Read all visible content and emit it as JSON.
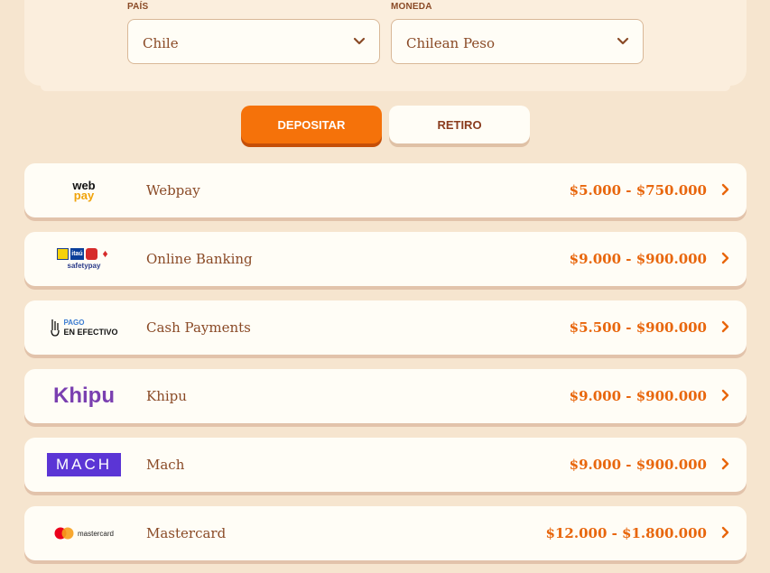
{
  "filters": {
    "country": {
      "label": "PAÍS",
      "value": "Chile"
    },
    "currency": {
      "label": "MONEDA",
      "value": "Chilean Peso"
    }
  },
  "tabs": [
    {
      "label": "DEPOSITAR",
      "active": true
    },
    {
      "label": "RETIRO",
      "active": false
    }
  ],
  "methods": [
    {
      "name": "Webpay",
      "range": "$5.000 - $750.000",
      "logo_text_1": "web",
      "logo_text_2": "pay"
    },
    {
      "name": "Online Banking",
      "range": "$9.000 - $900.000",
      "logo_text_1": "itaú",
      "logo_text_2": "safetypay"
    },
    {
      "name": "Cash Payments",
      "range": "$5.500 - $900.000",
      "logo_text_1": "PAGO",
      "logo_text_2": "EN EFECTIVO"
    },
    {
      "name": "Khipu",
      "range": "$9.000 - $900.000",
      "logo_text_1": "Khipu"
    },
    {
      "name": "Mach",
      "range": "$9.000 - $900.000",
      "logo_text_1": "MACH"
    },
    {
      "name": "Mastercard",
      "range": "$12.000 - $1.800.000",
      "logo_text_1": "mastercard"
    }
  ],
  "colors": {
    "accent": "#f5720a",
    "text": "#8a4a26",
    "background": "#f6e5cf"
  }
}
